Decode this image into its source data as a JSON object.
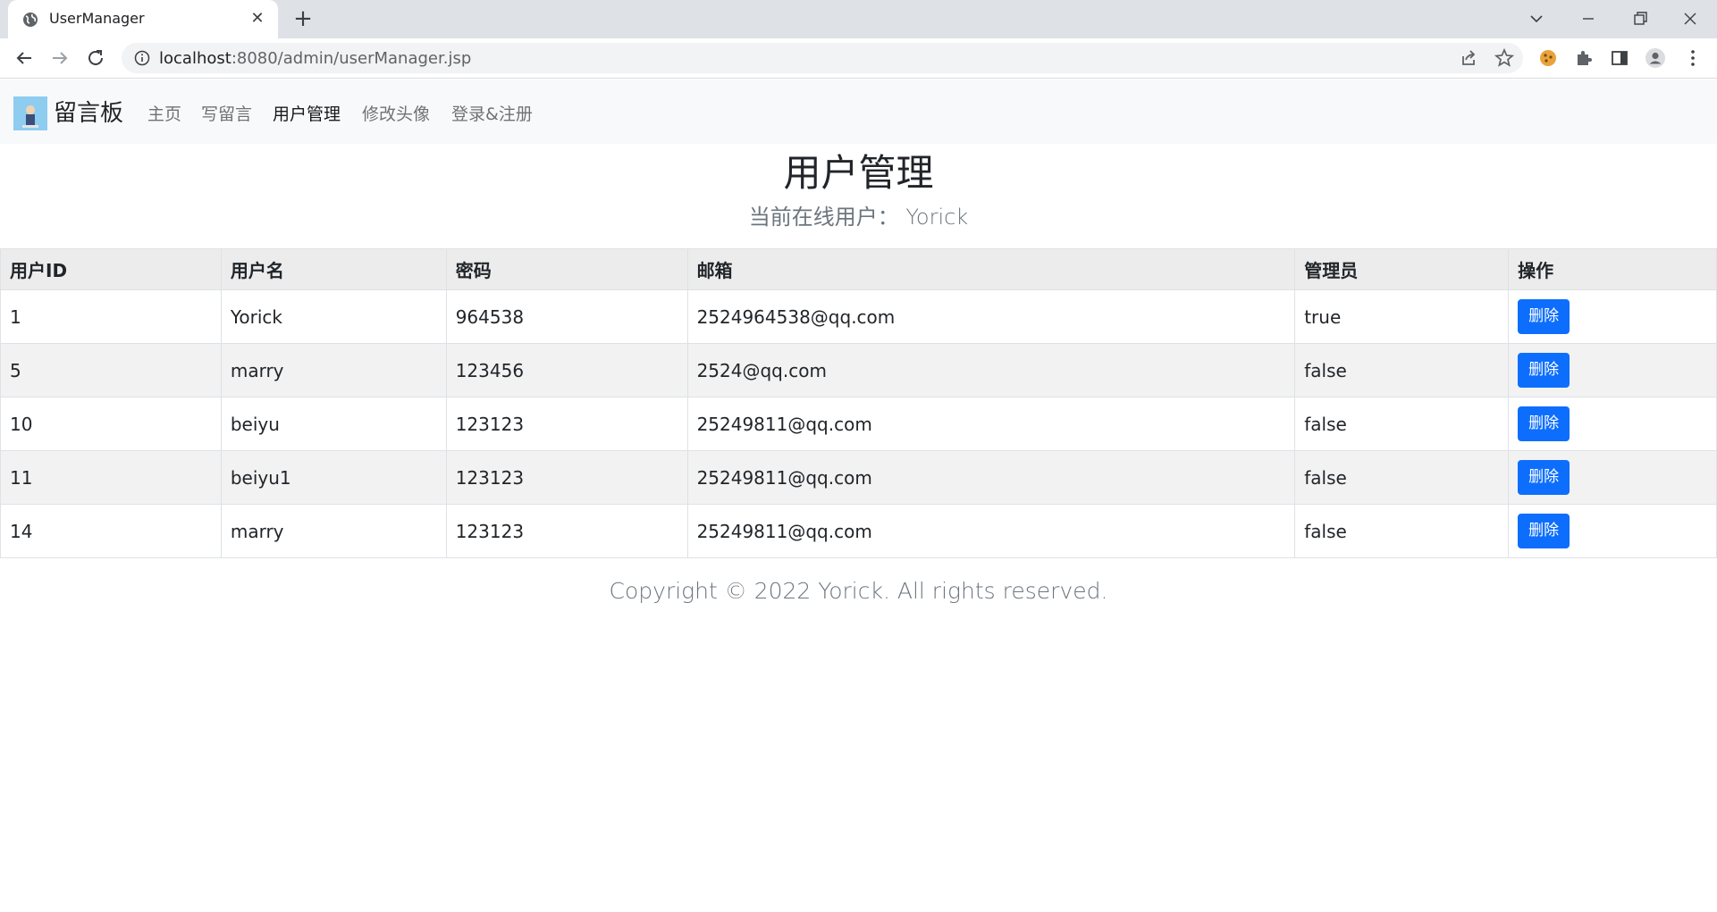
{
  "browser": {
    "tab_title": "UserManager",
    "url_host": "localhost",
    "url_rest": ":8080/admin/userManager.jsp",
    "icons": [
      "globe-icon",
      "close-icon",
      "plus-icon",
      "back-icon",
      "forward-icon",
      "reload-icon",
      "info-icon",
      "share-icon",
      "star-icon",
      "cookie-icon",
      "puzzle-icon",
      "sidepanel-icon",
      "profile-icon",
      "more-icon"
    ]
  },
  "navbar": {
    "brand": "留言板",
    "links": [
      {
        "label": "主页"
      },
      {
        "label": "写留言"
      },
      {
        "label": "用户管理"
      },
      {
        "label": "修改头像"
      },
      {
        "label": "登录&注册"
      }
    ],
    "active_link": "用户管理"
  },
  "page": {
    "title": "用户管理",
    "online_label": "当前在线用户：",
    "online_user": "Yorick"
  },
  "table": {
    "headers": [
      "用户ID",
      "用户名",
      "密码",
      "邮箱",
      "管理员",
      "操作"
    ],
    "rows": [
      {
        "id": "1",
        "name": "Yorick",
        "password": "964538",
        "email": "2524964538@qq.com",
        "admin": "true",
        "action": "删除"
      },
      {
        "id": "5",
        "name": "marry",
        "password": "123456",
        "email": "2524@qq.com",
        "admin": "false",
        "action": "删除"
      },
      {
        "id": "10",
        "name": "beiyu",
        "password": "123123",
        "email": "25249811@qq.com",
        "admin": "false",
        "action": "删除"
      },
      {
        "id": "11",
        "name": "beiyu1",
        "password": "123123",
        "email": "25249811@qq.com",
        "admin": "false",
        "action": "删除"
      },
      {
        "id": "14",
        "name": "marry",
        "password": "123123",
        "email": "25249811@qq.com",
        "admin": "false",
        "action": "删除"
      }
    ]
  },
  "footer": {
    "text": "Copyright © 2022 Yorick. All rights reserved."
  },
  "colors": {
    "primary": "#0d6efd",
    "navbar_bg": "#f8f9fa",
    "chrome_bg": "#dee1e6"
  }
}
